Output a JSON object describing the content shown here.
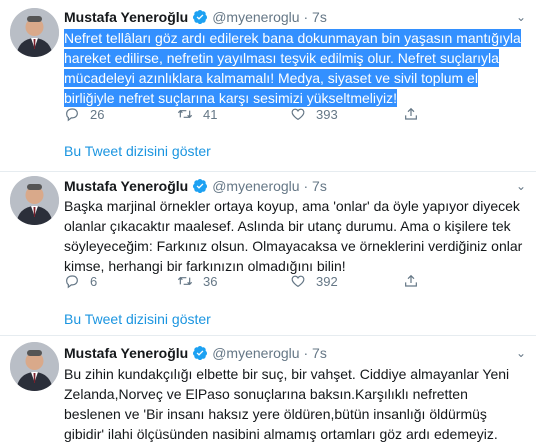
{
  "tweets": [
    {
      "name": "Mustafa Yeneroğlu",
      "handle": "@myeneroglu",
      "dot": "·",
      "time": "7s",
      "text": "Nefret tellâları göz ardı edilerek bana dokunmayan bin yaşasın mantığıyla hareket edilirse, nefretin yayılması teşvik edilmiş olur. Nefret suçlarıyla mücadeleyi azınlıklara kalmamalı! Medya, siyaset ve sivil toplum el birliğiyle nefret suçlarına karşı sesimizi yükseltmeliyiz!",
      "replies": "26",
      "retweets": "41",
      "likes": "393",
      "thread_link": "Bu Tweet dizisini göster"
    },
    {
      "name": "Mustafa Yeneroğlu",
      "handle": "@myeneroglu",
      "dot": "·",
      "time": "7s",
      "text": "Başka marjinal örnekler ortaya koyup, ama 'onlar' da öyle yapıyor diyecek olanlar çıkacaktır maalesef. Aslında bir utanç durumu. Ama o kişilere tek söyleyeceğim: Farkınız olsun. Olmayacaksa ve örneklerini verdiğiniz onlar kimse, herhangi bir farkınızın olmadığını bilin!",
      "replies": "6",
      "retweets": "36",
      "likes": "392",
      "thread_link": "Bu Tweet dizisini göster"
    },
    {
      "name": "Mustafa Yeneroğlu",
      "handle": "@myeneroglu",
      "dot": "·",
      "time": "7s",
      "text": "Bu zihin kundakçılığı elbette bir suç, bir vahşet. Ciddiye almayanlar Yeni Zelanda,Norveç ve ElPaso sonuçlarına baksın.Karşılıklı nefretten beslenen ve 'Bir insanı haksız yere öldüren,bütün insanlığı öldürmüş gibidir' ilahi ölçüsünden nasibini almamış ortamları göz ardı edemeyiz."
    }
  ],
  "colors": {
    "link": "#1b95e0",
    "verified": "#1da1f2",
    "selection": "#3390ff",
    "muted": "#657786"
  },
  "icons": {
    "reply": "reply-icon",
    "retweet": "retweet-icon",
    "like": "heart-icon",
    "verified": "verified-badge-icon",
    "menu": "chevron-down-icon"
  }
}
